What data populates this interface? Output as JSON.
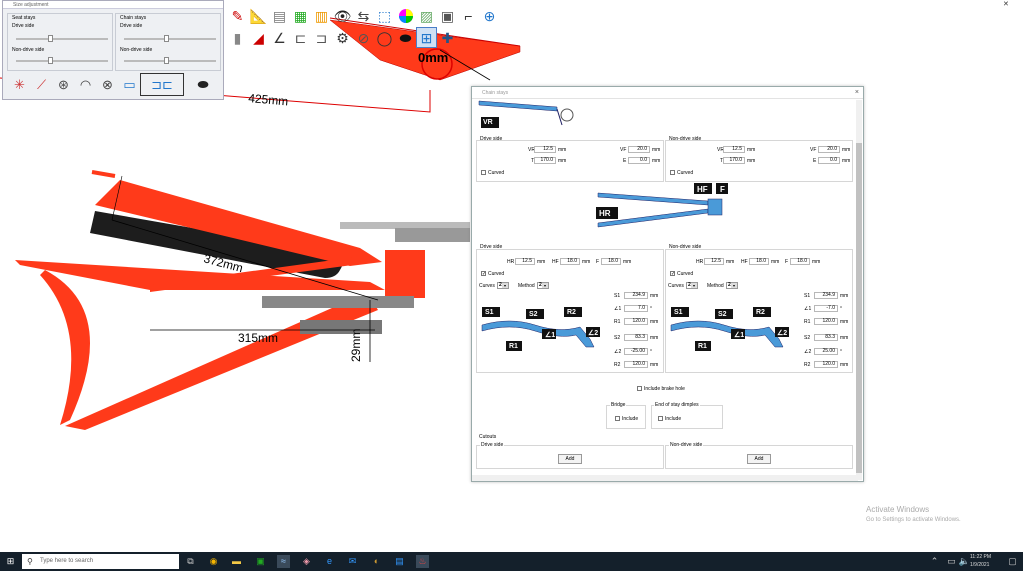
{
  "size_panel": {
    "title": "Size adjustment",
    "seat_stays": {
      "label": "Seat stays",
      "drive_side": "Drive side",
      "non_drive_side": "Non-drive side"
    },
    "chain_stays": {
      "label": "Chain stays",
      "drive_side": "Drive side",
      "non_drive_side": "Non-drive side"
    }
  },
  "canvas": {
    "dim_425": "425mm",
    "dim_372": "372mm",
    "dim_315": "315mm",
    "dim_29": "29mm",
    "dim_top": "0mm"
  },
  "dialog": {
    "title": "Chain stays",
    "close": "×",
    "vr_badge": "VR",
    "seat_drive_side": "Drive side",
    "seat_non_drive_side": "Non-drive side",
    "drive": {
      "vr_label": "VR",
      "vr_value": "12.5",
      "vr_unit": "mm",
      "t_label": "T",
      "t_value": "170.0",
      "t_unit": "mm",
      "vf_label": "VF",
      "vf_value": "20.0",
      "vf_unit": "mm",
      "e_label": "E",
      "e_value": "0.0",
      "e_unit": "mm",
      "curved_label": "Curved"
    },
    "nondrive": {
      "vr_label": "VR",
      "vr_value": "12.5",
      "vr_unit": "mm",
      "t_label": "T",
      "t_value": "170.0",
      "t_unit": "mm",
      "vf_label": "VF",
      "vf_value": "20.0",
      "vf_unit": "mm",
      "e_label": "E",
      "e_value": "0.0",
      "e_unit": "mm",
      "curved_label": "Curved"
    },
    "diagram_labels": {
      "hf": "HF",
      "f": "F",
      "hr": "HR"
    },
    "chain_drive": {
      "section": "Drive side",
      "hr_label": "HR",
      "hr_value": "12.5",
      "hr_unit": "mm",
      "hf_label": "HF",
      "hf_value": "18.0",
      "hf_unit": "mm",
      "f_label": "F",
      "f_value": "18.0",
      "f_unit": "mm",
      "curved_label": "Curved",
      "curves_label": "Curves",
      "curves_value": "2",
      "method_label": "Method",
      "method_value": "2",
      "s1_label": "S1",
      "s1_value": "234.9",
      "s1_unit": "mm",
      "a1_label": "∠1",
      "a1_value": "7.0",
      "a1_unit": "°",
      "r1_label": "R1",
      "r1_value": "120.0",
      "r1_unit": "mm",
      "s2_label": "S2",
      "s2_value": "83.3",
      "s2_unit": "mm",
      "a2_label": "∠2",
      "a2_value": "-25.00",
      "a2_unit": "°",
      "r2_label": "R2",
      "r2_value": "120.0",
      "r2_unit": "mm",
      "tags": {
        "s1": "S1",
        "s2": "S2",
        "r2": "R2",
        "a1": "∠1",
        "a2": "∠2",
        "r1": "R1"
      }
    },
    "chain_nondrive": {
      "section": "Non-drive side",
      "hr_label": "HR",
      "hr_value": "12.5",
      "hr_unit": "mm",
      "hf_label": "HF",
      "hf_value": "18.0",
      "hf_unit": "mm",
      "f_label": "F",
      "f_value": "18.0",
      "f_unit": "mm",
      "curved_label": "Curved",
      "curves_label": "Curves",
      "curves_value": "2",
      "method_label": "Method",
      "method_value": "2",
      "s1_label": "S1",
      "s1_value": "234.9",
      "s1_unit": "mm",
      "a1_label": "∠1",
      "a1_value": "-7.0",
      "a1_unit": "°",
      "r1_label": "R1",
      "r1_value": "120.0",
      "r1_unit": "mm",
      "s2_label": "S2",
      "s2_value": "83.3",
      "s2_unit": "mm",
      "a2_label": "∠2",
      "a2_value": "25.00",
      "a2_unit": "°",
      "r2_label": "R2",
      "r2_value": "120.0",
      "r2_unit": "mm",
      "tags": {
        "s1": "S1",
        "s2": "S2",
        "r2": "R2",
        "a1": "∠1",
        "a2": "∠2",
        "r1": "R1"
      }
    },
    "include_brake_hole": "Include brake hole",
    "bridge": {
      "label": "Bridge",
      "include": "Include"
    },
    "dimples": {
      "label": "End of stay dimples",
      "include": "Include"
    },
    "cutouts": {
      "label": "Cutouts",
      "drive_side": "Drive side",
      "non_drive_side": "Non-drive side",
      "add": "Add"
    }
  },
  "watermark": {
    "line1": "Activate Windows",
    "line2": "Go to Settings to activate Windows."
  },
  "taskbar": {
    "search_placeholder": "Type here to search",
    "time": "11:22 PM",
    "date": "1/9/2021"
  }
}
